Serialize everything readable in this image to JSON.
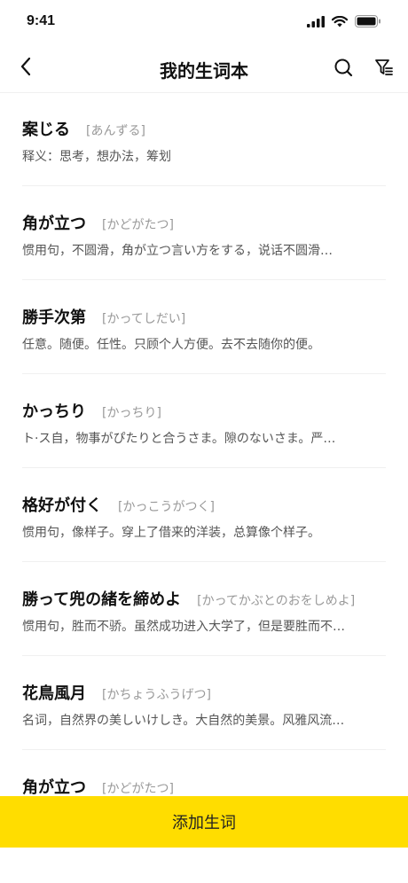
{
  "status_bar": {
    "time": "9:41"
  },
  "nav": {
    "title": "我的生词本"
  },
  "words": [
    {
      "term": "案じる",
      "reading": "[あんずる]",
      "meaning": "释义：思考，想办法，筹划"
    },
    {
      "term": "角が立つ",
      "reading": "[かどがたつ]",
      "meaning": "惯用句，不圆滑，角が立つ言い方をする，说话不圆滑…"
    },
    {
      "term": "勝手次第",
      "reading": "[かってしだい]",
      "meaning": "任意。随便。任性。只顾个人方便。去不去随你的便。"
    },
    {
      "term": "かっちり",
      "reading": "[かっちり]",
      "meaning": "ト·ス自，物事がぴたりと合うさま。隙のないさま。严…"
    },
    {
      "term": "格好が付く",
      "reading": "[かっこうがつく]",
      "meaning": "惯用句，像样子。穿上了借来的洋装，总算像个样子。"
    },
    {
      "term": "勝って兜の緒を締めよ",
      "reading": "[かってかぶとのおをしめよ]",
      "meaning": "惯用句，胜而不骄。虽然成功进入大学了，但是要胜而不…"
    },
    {
      "term": "花鳥風月",
      "reading": "[かちょうふうげつ]",
      "meaning": "名词，自然界の美しいけしき。大自然的美景。风雅风流…"
    },
    {
      "term": "角が立つ",
      "reading": "[かどがたつ]",
      "meaning": ""
    }
  ],
  "add_button": {
    "label": "添加生词"
  },
  "colors": {
    "accent": "#ffdd00",
    "reading": "#999999",
    "meaning": "#555555",
    "divider": "#f0f0f0"
  },
  "icons": [
    "back-arrow-icon",
    "search-icon",
    "filter-icon",
    "signal-icon",
    "wifi-icon",
    "battery-icon"
  ]
}
